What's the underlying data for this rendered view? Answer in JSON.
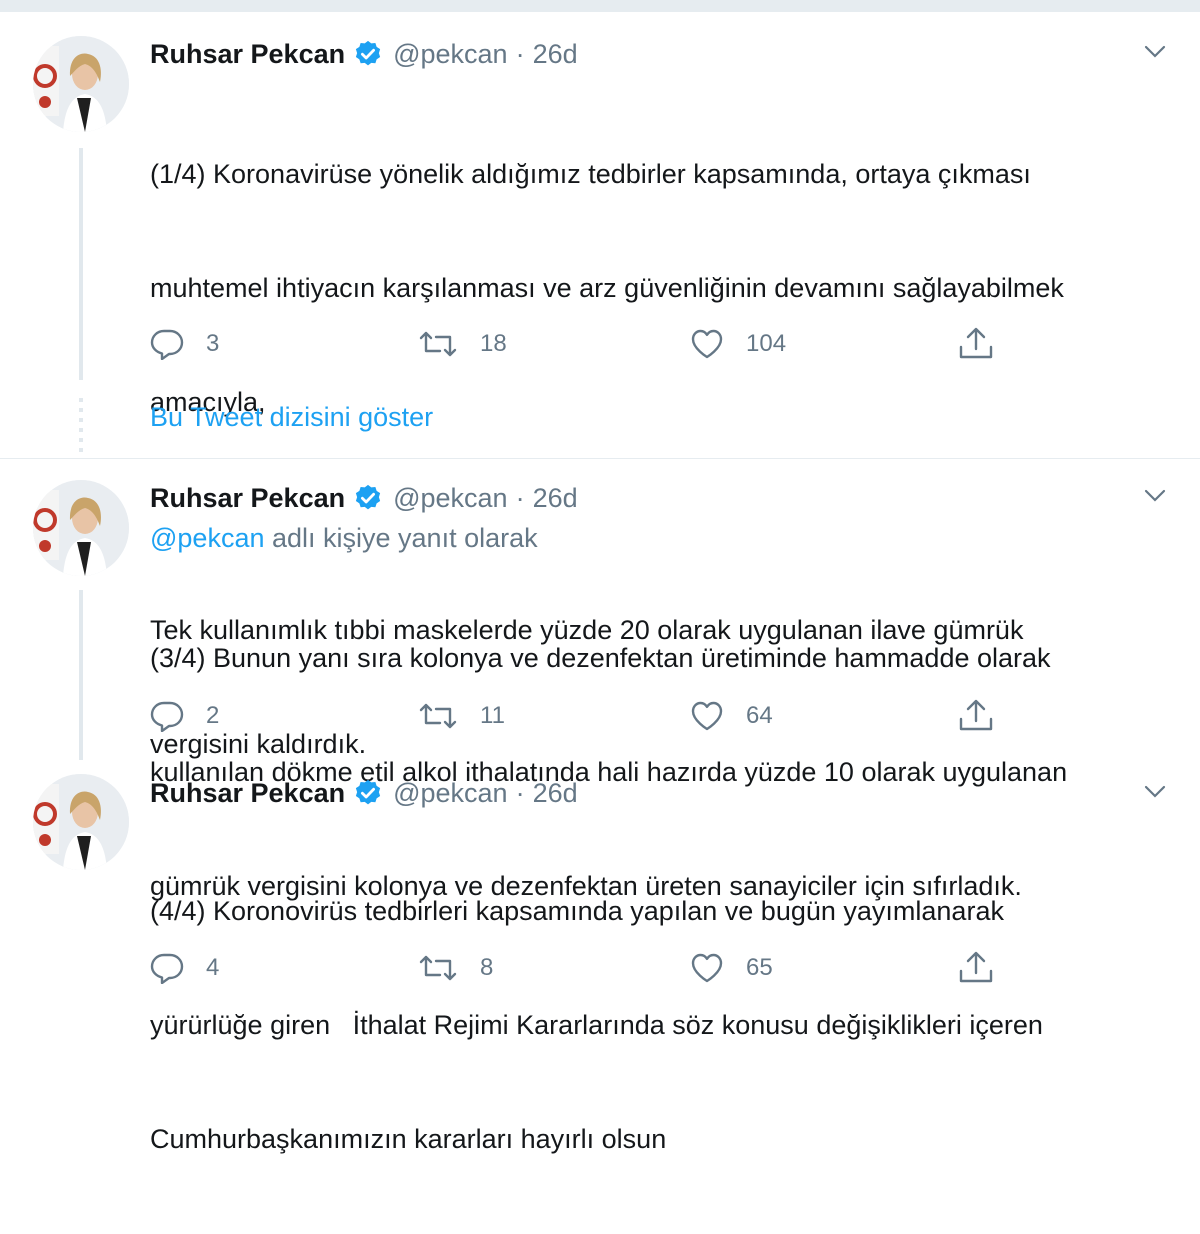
{
  "colors": {
    "accent": "#1da1f2",
    "text": "#14171a",
    "muted": "#657786",
    "separator": "#e6ecf0"
  },
  "show_thread_label": "Bu Tweet dizisini göster",
  "tweets": [
    {
      "author": {
        "name": "Ruhsar Pekcan",
        "handle": "@pekcan",
        "verified": true
      },
      "separator": "·",
      "time": "26d",
      "reply_to": null,
      "lines": [
        "(1/4) Koronavirüse yönelik aldığımız tedbirler kapsamında, ortaya çıkması",
        "muhtemel ihtiyacın karşılanması ve arz güvenliğinin devamını sağlayabilmek",
        "amacıyla,",
        "",
        "Tek kullanımlık tıbbi maskelerde yüzde 20 olarak uygulanan ilave gümrük",
        "vergisini kaldırdık."
      ],
      "stats": {
        "replies": "3",
        "retweets": "18",
        "likes": "104"
      }
    },
    {
      "author": {
        "name": "Ruhsar Pekcan",
        "handle": "@pekcan",
        "verified": true
      },
      "separator": "·",
      "time": "26d",
      "reply_to": {
        "handle": "@pekcan",
        "suffix": " adlı kişiye yanıt olarak"
      },
      "lines": [
        "(3/4) Bunun yanı sıra kolonya ve dezenfektan üretiminde hammadde olarak",
        "kullanılan dökme etil alkol ithalatında hali hazırda yüzde 10 olarak uygulanan",
        "gümrük vergisini kolonya ve dezenfektan üreten sanayiciler için sıfırladık."
      ],
      "stats": {
        "replies": "2",
        "retweets": "11",
        "likes": "64"
      }
    },
    {
      "author": {
        "name": "Ruhsar Pekcan",
        "handle": "@pekcan",
        "verified": true
      },
      "separator": "·",
      "time": "26d",
      "reply_to": null,
      "lines": [
        "(4/4) Koronovirüs tedbirleri kapsamında yapılan ve bugün yayımlanarak",
        "yürürlüğe giren   İthalat Rejimi Kararlarında söz konusu değişiklikleri içeren",
        "Cumhurbaşkanımızın kararları hayırlı olsun"
      ],
      "stats": {
        "replies": "4",
        "retweets": "8",
        "likes": "65"
      }
    }
  ],
  "icons": {
    "reply": "reply-icon",
    "retweet": "retweet-icon",
    "like": "like-icon",
    "share": "share-icon",
    "verified": "verified-icon",
    "more": "chevron-down-icon"
  }
}
